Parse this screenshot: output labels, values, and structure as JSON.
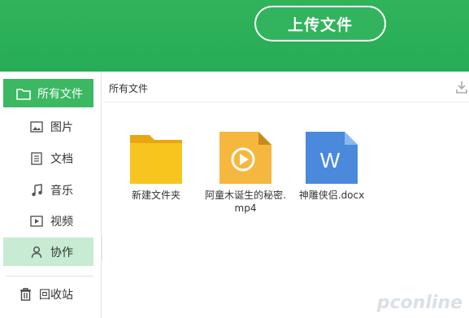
{
  "header": {
    "upload_label": "上传文件"
  },
  "sidebar": {
    "all_files": "所有文件",
    "items": [
      {
        "label": "图片",
        "icon": "image-icon"
      },
      {
        "label": "文档",
        "icon": "document-icon"
      },
      {
        "label": "音乐",
        "icon": "music-icon"
      },
      {
        "label": "视频",
        "icon": "video-icon"
      },
      {
        "label": "协作",
        "icon": "user-icon"
      }
    ],
    "trash": "回收站"
  },
  "main": {
    "breadcrumb": "所有文件",
    "files": [
      {
        "name": "新建文件夹",
        "type": "folder"
      },
      {
        "name": "阿童木诞生的秘密.mp4",
        "type": "video"
      },
      {
        "name": "神雕侠侣.docx",
        "type": "word"
      }
    ]
  },
  "watermark": {
    "text": "pconline"
  },
  "colors": {
    "brand_green": "#2fb35b",
    "active_light": "#c7ecd3",
    "folder": "#f7c51e",
    "video": "#f5b73d",
    "word": "#4a89dc"
  }
}
